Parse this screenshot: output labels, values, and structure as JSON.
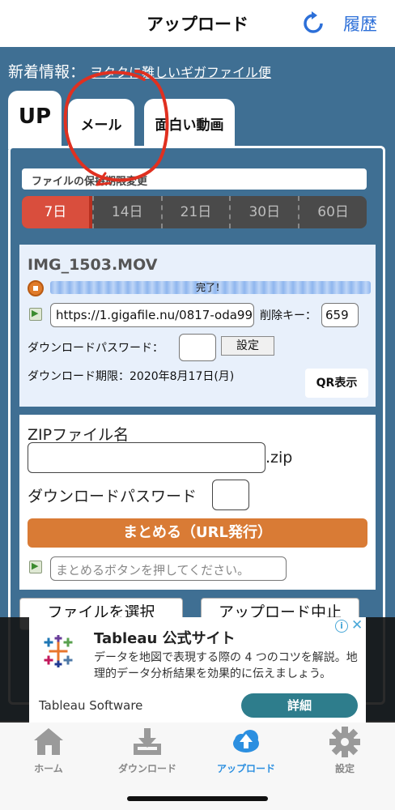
{
  "header": {
    "title": "アップロード",
    "history_label": "履歴",
    "refresh_icon": "refresh-icon"
  },
  "news": {
    "label": "新着情報：",
    "link_text": "ヲタクに難しいギガファイル便"
  },
  "tabs": [
    {
      "label": "UP",
      "active": true
    },
    {
      "label": "メール"
    },
    {
      "label": "面白い動画"
    }
  ],
  "retention": {
    "label": "ファイルの保持期限変更",
    "options": [
      "7日",
      "14日",
      "21日",
      "30日",
      "60日"
    ],
    "selected": "7日"
  },
  "file": {
    "name": "IMG_1503.MOV",
    "status": "完了！",
    "progress": 1.0,
    "url": "https://1.gigafile.nu/0817-oda99",
    "delete_key_label": "削除キー：",
    "delete_key": "659",
    "download_password_label": "ダウンロードパスワード：",
    "set_button": "設定",
    "deadline": "ダウンロード期限：2020年8月17日(月)",
    "qr_button": "QR表示"
  },
  "zip": {
    "filename_label": "ZIPファイル名",
    "extension": ".zip",
    "password_label": "ダウンロードパスワード",
    "merge_button": "まとめる（URL発行）",
    "merge_placeholder": "まとめるボタンを押してください。"
  },
  "actions": {
    "select_file": "ファイルを選択",
    "stop_upload": "アップロード中止"
  },
  "ad": {
    "title": "Tableau 公式サイト",
    "text": "データを地図で表現する際の 4 つのコツを解説。地理的データ分析結果を効果的に伝えましょう。",
    "advertiser": "Tableau Software",
    "button": "詳細",
    "close_icon": "close-icon",
    "info_icon": "info-icon"
  },
  "nav": [
    {
      "label": "ホーム",
      "icon": "home-icon"
    },
    {
      "label": "ダウンロード",
      "icon": "download-icon"
    },
    {
      "label": "アップロード",
      "icon": "upload-cloud-icon",
      "active": true
    },
    {
      "label": "設定",
      "icon": "gear-icon"
    }
  ],
  "colors": {
    "header_bg": "#ffffff",
    "accent_blue": "#2c6fd8",
    "page_bg": "#3f6f93",
    "retention_active": "#d94e3d",
    "merge_button": "#d97b35",
    "ad_button": "#2e7d8c",
    "annotation_red": "#e03020"
  }
}
